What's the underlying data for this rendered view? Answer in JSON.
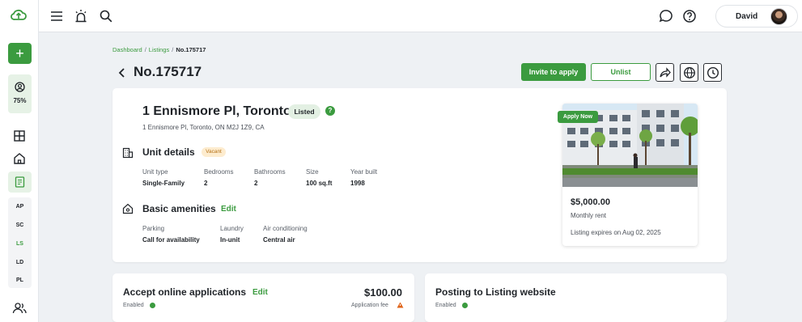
{
  "sidebar": {
    "profile_progress": "75%",
    "section_letters": [
      {
        "label": "AP",
        "active": false
      },
      {
        "label": "SC",
        "active": false
      },
      {
        "label": "LS",
        "active": true
      },
      {
        "label": "LD",
        "active": false
      },
      {
        "label": "PL",
        "active": false
      }
    ]
  },
  "topbar": {
    "user_name": "David"
  },
  "breadcrumb": [
    "Dashboard",
    "Listings",
    "No.175717"
  ],
  "page": {
    "title": "No.175717",
    "invite_label": "Invite to apply",
    "unlist_label": "Unlist"
  },
  "property": {
    "title": "1 Ennismore Pl, Toronto",
    "status": "Listed",
    "address": "1 Ennismore Pl, Toronto, ON M2J 1Z9, CA"
  },
  "unit_details": {
    "heading": "Unit details",
    "badge": "Vacant",
    "fields": [
      {
        "label": "Unit type",
        "value": "Single-Family"
      },
      {
        "label": "Bedrooms",
        "value": "2"
      },
      {
        "label": "Bathrooms",
        "value": "2"
      },
      {
        "label": "Size",
        "value": "100 sq.ft"
      },
      {
        "label": "Year built",
        "value": "1998"
      }
    ]
  },
  "amenities": {
    "heading": "Basic amenities",
    "edit_label": "Edit",
    "fields": [
      {
        "label": "Parking",
        "value": "Call for availability"
      },
      {
        "label": "Laundry",
        "value": "In-unit"
      },
      {
        "label": "Air conditioning",
        "value": "Central air"
      }
    ]
  },
  "preview": {
    "badge": "Apply Now",
    "price": "$5,000.00",
    "rent_label": "Monthly rent",
    "expires": "Listing expires on Aug 02, 2025"
  },
  "applications": {
    "title": "Accept online applications",
    "edit_label": "Edit",
    "status": "Enabled",
    "fee": "$100.00",
    "fee_label": "Application fee"
  },
  "posting": {
    "title": "Posting to Listing website",
    "status": "Enabled"
  },
  "colors": {
    "brand_green": "#3b9b3f",
    "vacant_bg": "#fdeccf",
    "warning": "#e0651b"
  }
}
